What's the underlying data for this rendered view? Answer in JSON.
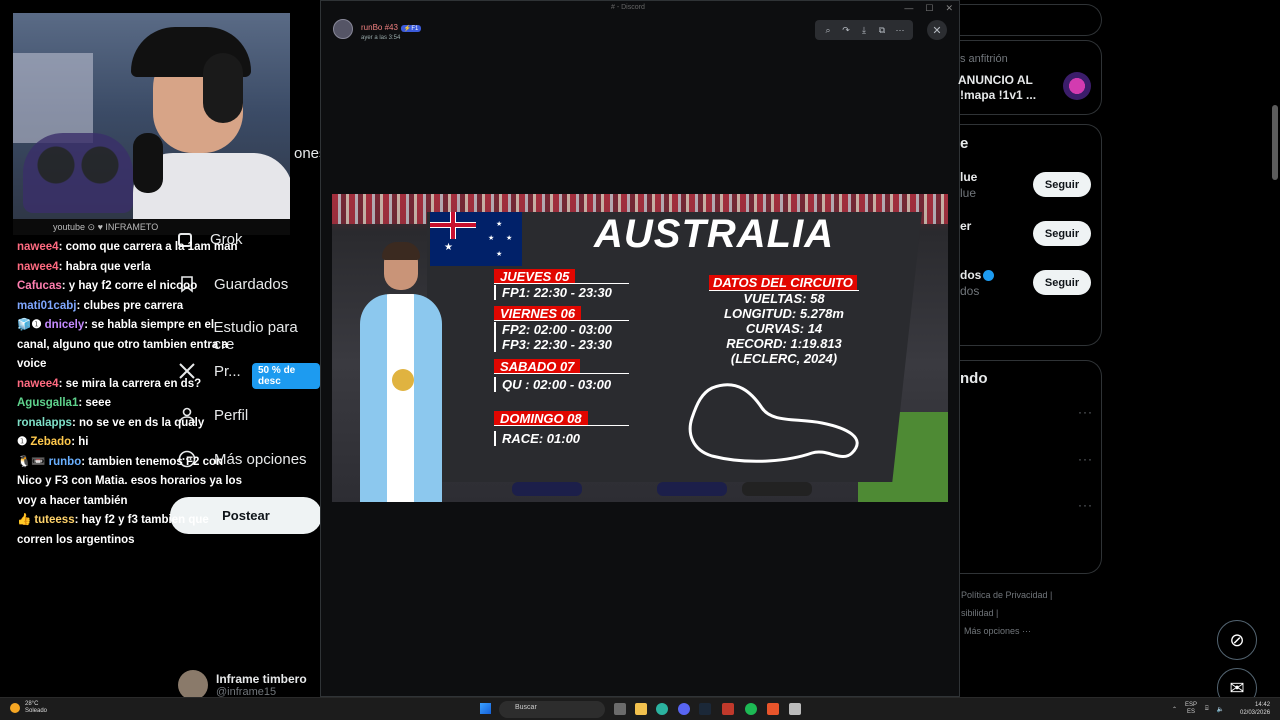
{
  "webcam": {
    "strip_text": "youtube ⊙ ♥ INFRAMETO"
  },
  "chat": [
    {
      "user": "nawee4",
      "color": "#ff6b81",
      "text": ": como que carrera a la 1am man"
    },
    {
      "user": "nawee4",
      "color": "#ff6b81",
      "text": ": habra que verla"
    },
    {
      "user": "Cafucas",
      "color": "#ff7fb0",
      "text": ": y hay f2 corre el nicooo"
    },
    {
      "user": "mati01cabj",
      "color": "#7fa7ff",
      "text": ": clubes pre carrera"
    },
    {
      "user": "dnicely",
      "color": "#c58bff",
      "badge": "🧊❶",
      "text": ": se habla siempre en el canal, alguno que otro tambien entra a voice"
    },
    {
      "user": "nawee4",
      "color": "#ff6b81",
      "text": ": se mira la carrera en ds?"
    },
    {
      "user": "Agusgalla1",
      "color": "#5fd38d",
      "text": ": seee"
    },
    {
      "user": "ronalapps",
      "color": "#7fe0c8",
      "text": ": no se ve en ds la qualy"
    },
    {
      "user": "Zebado",
      "color": "#ffc94d",
      "badge": "❶",
      "text": ": hi"
    },
    {
      "user": "runbo",
      "color": "#6ab0ff",
      "badge": "🐧📼",
      "text": ": tambien tenemos F2 con Nico y F3 con Matia. esos horarios ya los voy a hacer también"
    },
    {
      "user": "tuteess",
      "color": "#ffd36b",
      "badge": "👍",
      "text": ": hay f2 y f3 tambien que corren los argentinos"
    }
  ],
  "xnav": {
    "items": [
      {
        "label": "ones",
        "icon": "notifications-icon"
      },
      {
        "label": "Grok",
        "icon": "grok-icon"
      },
      {
        "label": "Guardados",
        "icon": "bookmark-icon"
      },
      {
        "label": "Estudio para cre",
        "icon": "studio-icon"
      },
      {
        "label": "Pr...",
        "icon": "x-logo-icon"
      },
      {
        "label": "Perfil",
        "icon": "person-icon"
      },
      {
        "label": "Más opciones",
        "icon": "more-circle-icon"
      }
    ],
    "discount": "50 % de desc",
    "post_label": "Postear",
    "profile_name": "Inframe timbero",
    "profile_handle": "@inframe15"
  },
  "viewer": {
    "window_title": "# - Discord",
    "author": "runBo #43",
    "tag": "⚡F1",
    "timestamp": "ayer a las 3:54",
    "toolbar_icons": [
      "zoom-icon",
      "forward-icon",
      "download-icon",
      "open-icon",
      "more-icon"
    ]
  },
  "poster": {
    "title": "AUSTRALIA",
    "schedule": [
      {
        "day": "JUEVES   05",
        "sessions": [
          "FP1: 22:30 - 23:30"
        ]
      },
      {
        "day": "VIERNES   06",
        "sessions": [
          "FP2: 02:00 - 03:00",
          "FP3: 22:30 - 23:30"
        ]
      },
      {
        "day": "SABADO   07",
        "sessions": [
          "QU : 02:00 - 03:00"
        ]
      },
      {
        "day": "DOMINGO 08",
        "sessions": [
          "RACE: 01:00"
        ]
      }
    ],
    "circuit_title": "DATOS DEL CIRCUITO",
    "circuit_lines": [
      "VUELTAS: 58",
      "LONGITUD: 5.278m",
      "CURVAS: 14",
      "RECORD: 1:19.813",
      "(LECLERC, 2024)"
    ]
  },
  "rightcol": {
    "host_label": "s anfitrión",
    "space_title_1": "ANUNCIO AL",
    "space_title_2": "!mapa !1v1 ...",
    "who_follow_header": "e",
    "follow_rows": [
      {
        "name": "lue",
        "sub": "lue"
      },
      {
        "name": "er",
        "sub": ""
      },
      {
        "name": "dos",
        "sub": "dos"
      }
    ],
    "follow_label": "Seguir",
    "trends_header": "ndo",
    "footer_1": "Política de Privacidad   |",
    "footer_2": "sibilidad   |",
    "footer_3": "Más opciones ···"
  },
  "taskbar": {
    "temp": "28°C",
    "weather": "Soleado",
    "search_placeholder": "Buscar",
    "lang_1": "ESP",
    "lang_2": "ES",
    "time": "14:42",
    "date": "02/03/2026"
  }
}
